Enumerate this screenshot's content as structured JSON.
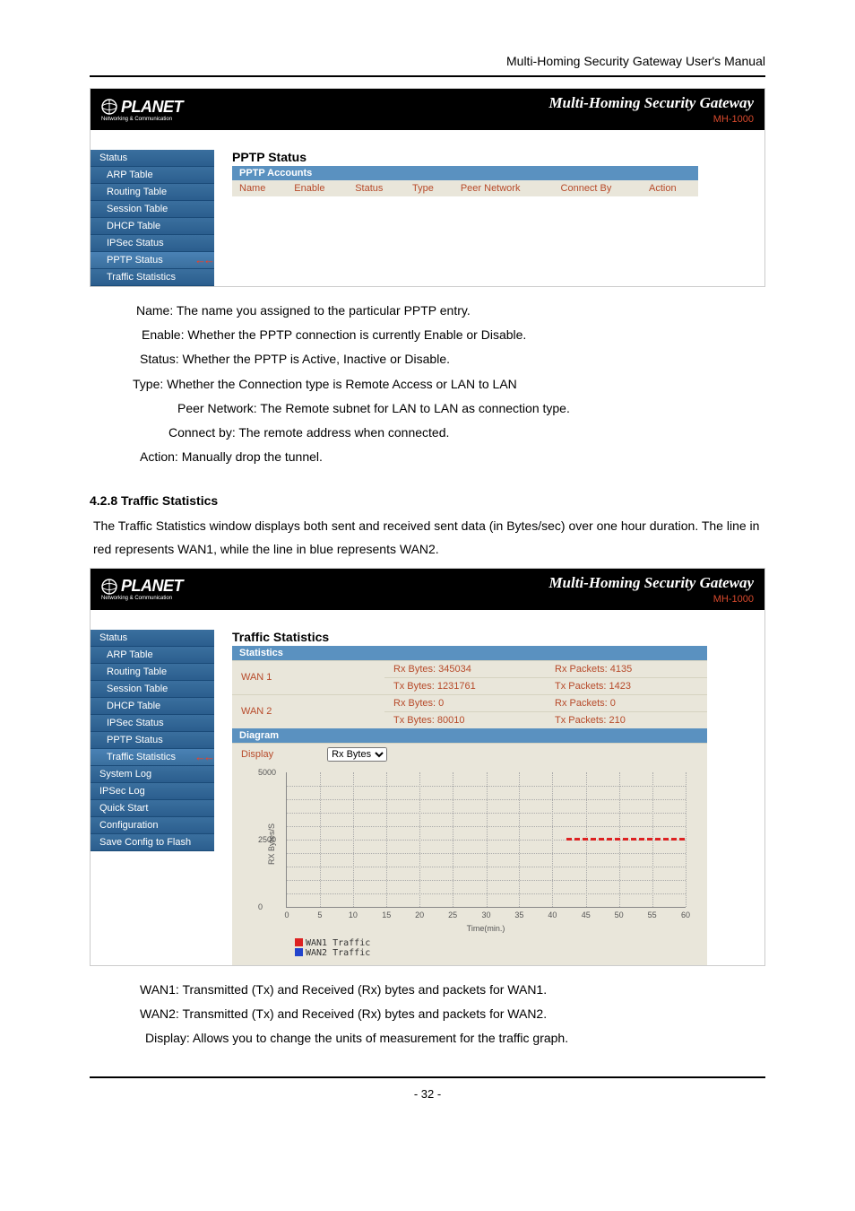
{
  "header": {
    "title": "Multi-Homing Security Gateway User's Manual"
  },
  "router_branding": {
    "logo": "PLANET",
    "logo_sub": "Networking & Communication",
    "title": "Multi-Homing Security Gateway",
    "model": "MH-1000"
  },
  "screenshot1": {
    "sidebar": {
      "items": [
        "Status",
        "ARP Table",
        "Routing Table",
        "Session Table",
        "DHCP Table",
        "IPSec Status",
        "PPTP Status",
        "Traffic Statistics"
      ]
    },
    "panel_title": "PPTP Status",
    "sub_bar": "PPTP Accounts",
    "table_headers": [
      "Name",
      "Enable",
      "Status",
      "Type",
      "Peer Network",
      "Connect By",
      "Action"
    ]
  },
  "field_desc1": {
    "name": "Name: The name you assigned to the particular PPTP entry.",
    "enable": "Enable: Whether the PPTP connection is currently Enable or Disable.",
    "status": "Status: Whether the PPTP is Active, Inactive or Disable.",
    "type": "Type: Whether the Connection type is Remote Access or LAN to LAN",
    "peer": "Peer Network: The Remote subnet for LAN to LAN as connection type.",
    "connect": "Connect by: The remote address when connected.",
    "action": "Action: Manually drop the tunnel."
  },
  "section2_heading": "4.2.8 Traffic Statistics",
  "section2_intro": "The Traffic Statistics window displays both sent and received sent data (in Bytes/sec) over one hour duration. The line in red represents WAN1, while the line in blue represents WAN2.",
  "screenshot2": {
    "sidebar": {
      "items": [
        "Status",
        "ARP Table",
        "Routing Table",
        "Session Table",
        "DHCP Table",
        "IPSec Status",
        "PPTP Status",
        "Traffic Statistics",
        "System Log",
        "IPSec Log",
        "Quick Start",
        "Configuration",
        "Save Config to Flash"
      ]
    },
    "panel_title": "Traffic Statistics",
    "sub_bar": "Statistics",
    "wan1": {
      "label": "WAN 1",
      "rx_bytes": "Rx Bytes: 345034",
      "rx_packets": "Rx Packets: 4135",
      "tx_bytes": "Tx Bytes: 1231761",
      "tx_packets": "Tx Packets: 1423"
    },
    "wan2": {
      "label": "WAN 2",
      "rx_bytes": "Rx Bytes: 0",
      "rx_packets": "Rx Packets: 0",
      "tx_bytes": "Tx Bytes: 80010",
      "tx_packets": "Tx Packets: 210"
    },
    "diagram_label": "Diagram",
    "display_label": "Display",
    "display_value": "Rx Bytes",
    "legend": {
      "wan1": "WAN1 Traffic",
      "wan2": "WAN2 Traffic"
    }
  },
  "chart_data": {
    "type": "line",
    "title": "",
    "xlabel": "Time(min.)",
    "ylabel": "RX Bytes/S",
    "x": [
      0,
      5,
      10,
      15,
      20,
      25,
      30,
      35,
      40,
      45,
      50,
      55,
      60
    ],
    "ylim": [
      0,
      5000
    ],
    "yticks": [
      0,
      2500,
      5000
    ],
    "series": [
      {
        "name": "WAN1 Traffic",
        "color": "#d22222",
        "values": [
          null,
          null,
          null,
          null,
          null,
          null,
          null,
          null,
          null,
          2550,
          2500,
          2520,
          2500
        ]
      },
      {
        "name": "WAN2 Traffic",
        "color": "#2244cc",
        "values": [
          null,
          null,
          null,
          null,
          null,
          null,
          null,
          null,
          null,
          null,
          null,
          null,
          null
        ]
      }
    ]
  },
  "field_desc2": {
    "wan1": "WAN1: Transmitted (Tx) and Received (Rx) bytes and packets for WAN1.",
    "wan2": "WAN2: Transmitted (Tx) and Received (Rx) bytes and packets for WAN2.",
    "display": "Display: Allows you to change the units of measurement for the traffic graph."
  },
  "page_number": "- 32 -"
}
